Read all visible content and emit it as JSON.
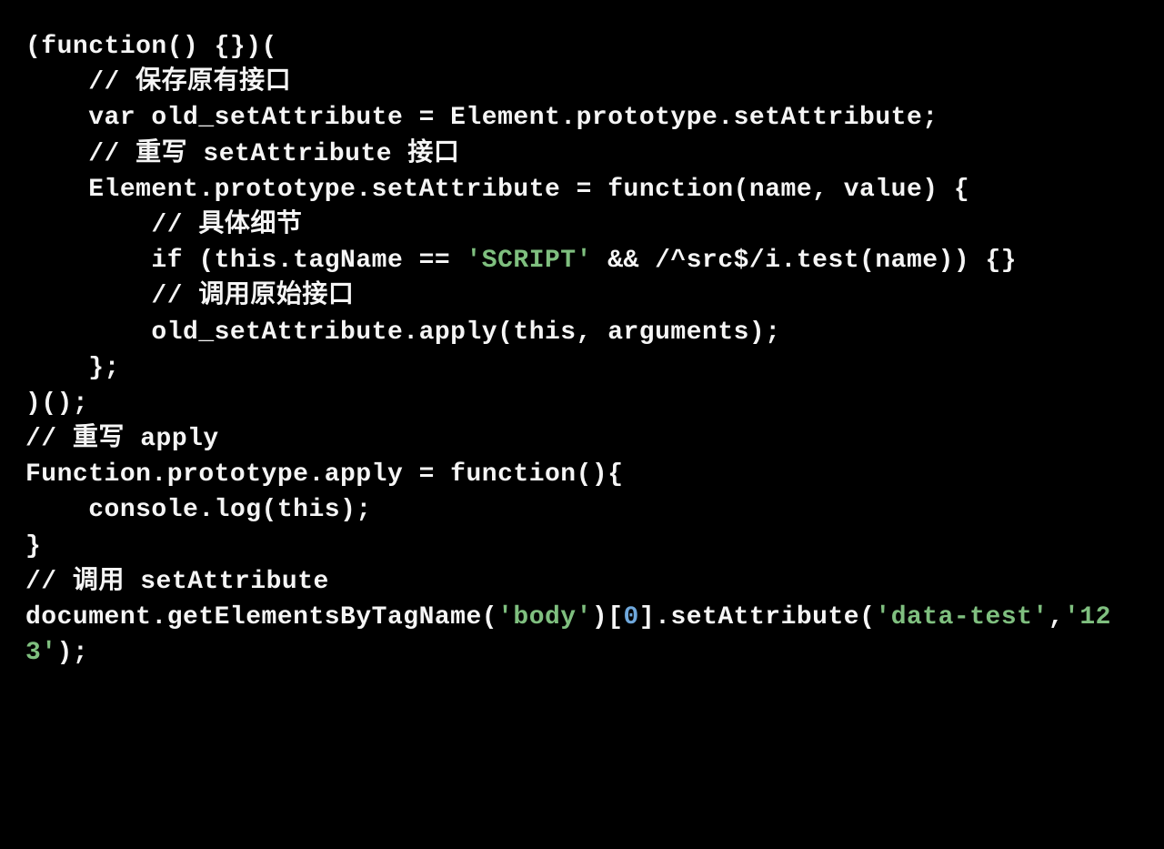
{
  "code": {
    "tokens": [
      {
        "t": "(function() {})(\n",
        "cls": ""
      },
      {
        "t": "    // 保存原有接口\n",
        "cls": ""
      },
      {
        "t": "    var old_setAttribute = Element.prototype.setAttribute;\n",
        "cls": ""
      },
      {
        "t": "    // 重写 setAttribute 接口\n",
        "cls": ""
      },
      {
        "t": "    Element.prototype.setAttribute = function(name, value) {\n",
        "cls": ""
      },
      {
        "t": "        // 具体细节\n",
        "cls": ""
      },
      {
        "t": "        if (this.tagName == ",
        "cls": ""
      },
      {
        "t": "'SCRIPT'",
        "cls": "str"
      },
      {
        "t": " && /^src$/i.test(name)) {}\n",
        "cls": ""
      },
      {
        "t": "        // 调用原始接口\n",
        "cls": ""
      },
      {
        "t": "        old_setAttribute.apply(this, arguments);\n",
        "cls": ""
      },
      {
        "t": "    };\n",
        "cls": ""
      },
      {
        "t": ")();\n",
        "cls": ""
      },
      {
        "t": "// 重写 apply\n",
        "cls": ""
      },
      {
        "t": "Function.prototype.apply = function(){\n",
        "cls": ""
      },
      {
        "t": "    console.log(this);\n",
        "cls": ""
      },
      {
        "t": "}\n",
        "cls": ""
      },
      {
        "t": "// 调用 setAttribute\n",
        "cls": ""
      },
      {
        "t": "document.getElementsByTagName(",
        "cls": ""
      },
      {
        "t": "'body'",
        "cls": "str"
      },
      {
        "t": ")[",
        "cls": ""
      },
      {
        "t": "0",
        "cls": "num"
      },
      {
        "t": "].setAttribute(",
        "cls": ""
      },
      {
        "t": "'data-test'",
        "cls": "str"
      },
      {
        "t": ",",
        "cls": ""
      },
      {
        "t": "'123'",
        "cls": "str"
      },
      {
        "t": ");",
        "cls": ""
      }
    ]
  }
}
